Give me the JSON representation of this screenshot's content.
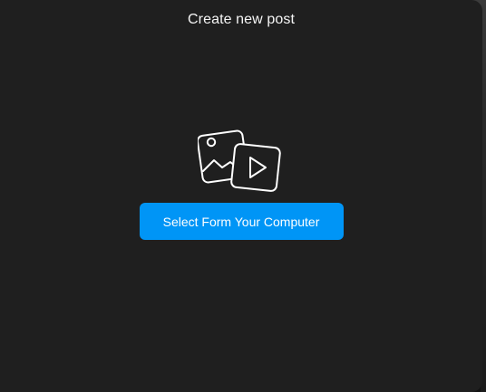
{
  "modal": {
    "title": "Create new post",
    "icon": "photo-video-icon",
    "button_label": "Select Form Your Computer"
  },
  "colors": {
    "modal_background": "#1f1f1f",
    "accent": "#0095f6",
    "text": "#f5f5f5"
  }
}
